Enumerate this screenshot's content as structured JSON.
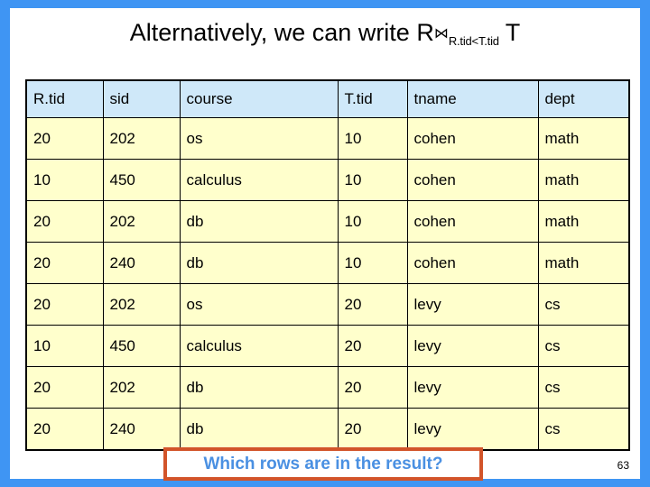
{
  "slide": {
    "frame_color": "#3f95f3",
    "background": "#ffffff",
    "page_number": "63"
  },
  "title": {
    "lead": "Alternatively, we can write R",
    "join_symbol": "⋈",
    "join_condition": "R.tid<T.tid",
    "right_relation": "T",
    "full_text": "Alternatively, we can write R ⋈ R.tid<T.tid T"
  },
  "table": {
    "header_background": "#cfe8f9",
    "cell_background": "#ffffcc",
    "border_color": "#000000",
    "columns": [
      "R.tid",
      "sid",
      "course",
      "T.tid",
      "tname",
      "dept"
    ],
    "rows": [
      [
        "20",
        "202",
        "os",
        "10",
        "cohen",
        "math"
      ],
      [
        "10",
        "450",
        "calculus",
        "10",
        "cohen",
        "math"
      ],
      [
        "20",
        "202",
        "db",
        "10",
        "cohen",
        "math"
      ],
      [
        "20",
        "240",
        "db",
        "10",
        "cohen",
        "math"
      ],
      [
        "20",
        "202",
        "os",
        "20",
        "levy",
        "cs"
      ],
      [
        "10",
        "450",
        "calculus",
        "20",
        "levy",
        "cs"
      ],
      [
        "20",
        "202",
        "db",
        "20",
        "levy",
        "cs"
      ],
      [
        "20",
        "240",
        "db",
        "20",
        "levy",
        "cs"
      ]
    ]
  },
  "callout": {
    "text": "Which rows are in the result?",
    "border_color": "#d2542a",
    "text_color": "#4a90e2"
  }
}
